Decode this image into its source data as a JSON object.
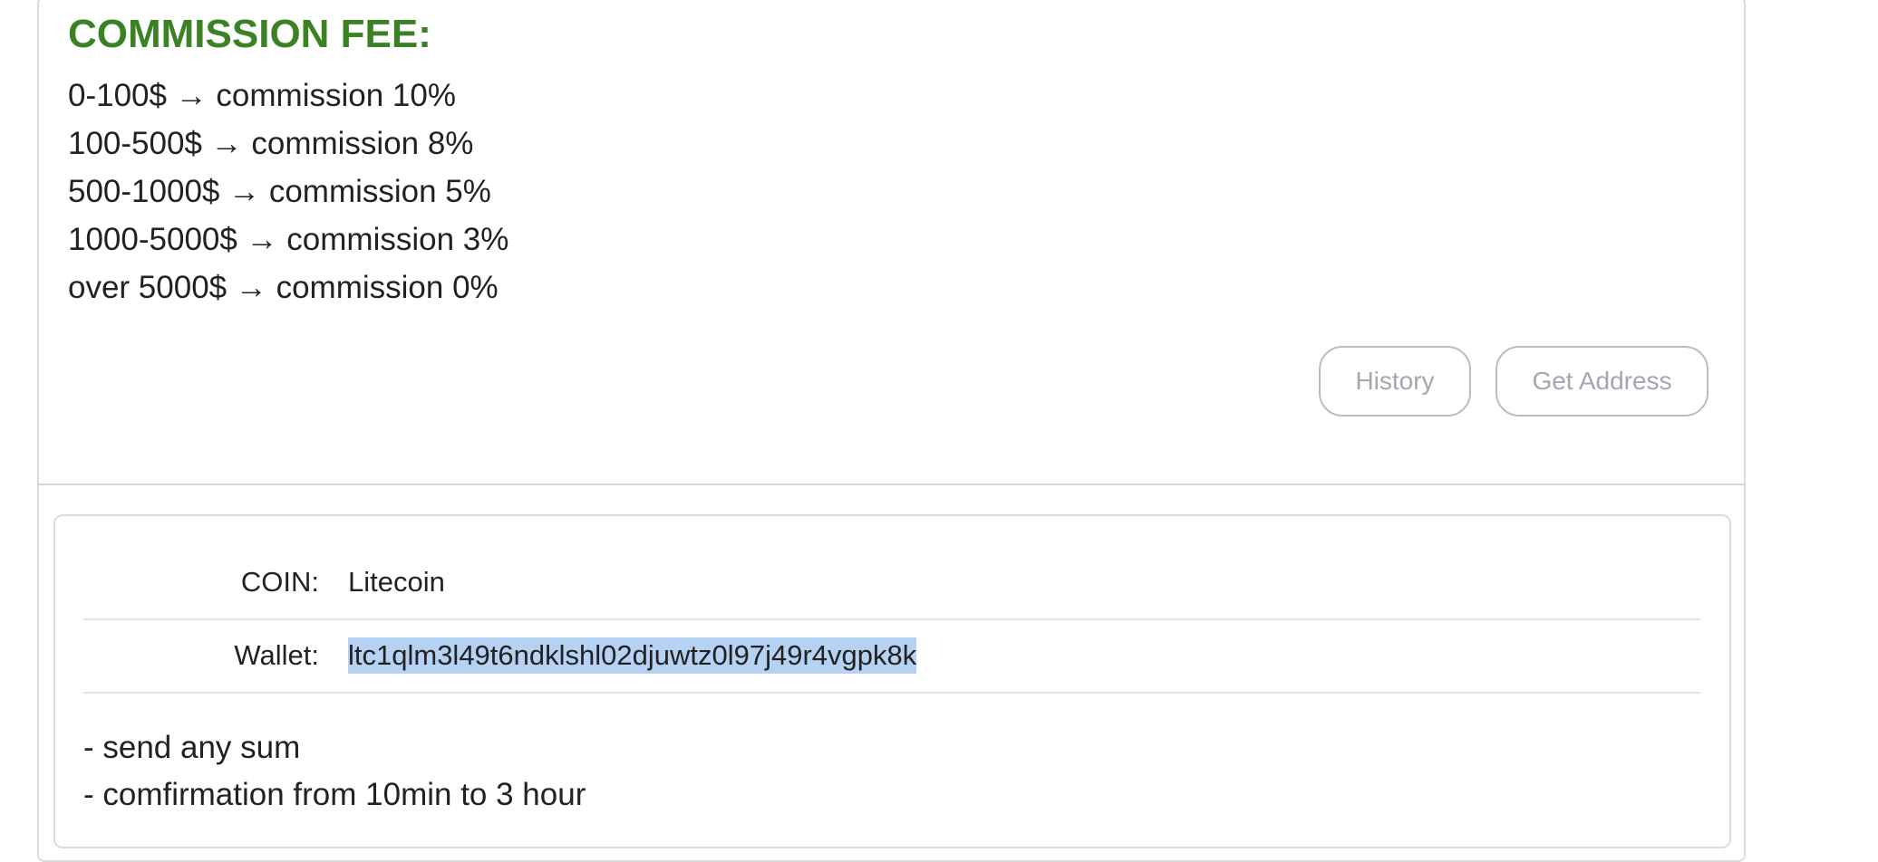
{
  "commission": {
    "title": "COMMISSION FEE:",
    "tiers": [
      "0-100$ → commission 10%",
      "100-500$ → commission 8%",
      "500-1000$ → commission 5%",
      "1000-5000$ → commission 3%",
      "over 5000$ → commission 0%"
    ]
  },
  "actions": {
    "history_label": "History",
    "get_address_label": "Get Address"
  },
  "details": {
    "coin_label": "COIN:",
    "coin_value": "Litecoin",
    "wallet_label": "Wallet:",
    "wallet_value": "ltc1qlm3l49t6ndklshl02djuwtz0l97j49r4vgpk8k",
    "notes": [
      "- send any sum",
      "- comfirmation from 10min to 3 hour"
    ]
  },
  "colors": {
    "title_green": "#3a8224",
    "button_border": "#b9bcc2",
    "button_text": "#a3a7ae",
    "selection_highlight": "#b5d2f3"
  }
}
